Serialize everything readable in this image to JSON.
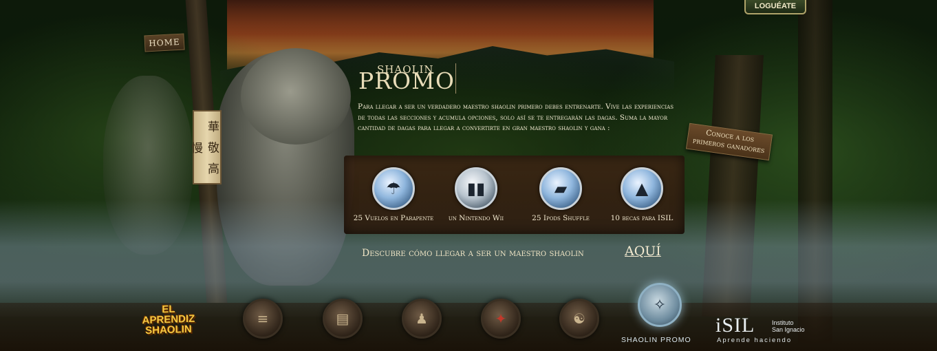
{
  "header": {
    "login_label": "LOGUÉATE",
    "home_label": "HOME"
  },
  "banner": {
    "characters": "華 敬 高 慢"
  },
  "promo": {
    "logo_small": "SHAOLIN",
    "logo_big": "PROMO",
    "intro": "Para llegar a ser un verdadero maestro shaolin primero debes entrenarte. Vive las experiencias de todas las secciones y acumula opciones, solo así se te entregarán las dagas. Suma la mayor cantidad de dagas para llegar a convertirte en gran maestro shaolin y gana :",
    "winners_label": "Conoce a los primeros ganadores",
    "prizes": [
      {
        "label": "25 Vuelos en Parapente",
        "icon": "paraglider-icon"
      },
      {
        "label": "un Nintendo Wii",
        "icon": "wii-console-icon"
      },
      {
        "label": "25 Ipods Shuffle",
        "icon": "ipod-shuffle-icon"
      },
      {
        "label": "10 becas para ISIL",
        "icon": "graduation-cap-icon"
      }
    ],
    "discover_text": "Descubre cómo llegar a ser un maestro shaolin",
    "discover_link": "AQUÍ"
  },
  "nav": {
    "active_label": "SHAOLIN PROMO"
  },
  "brand": {
    "aprendiz_line1": "EL",
    "aprendiz_line2": "APRENDIZ",
    "aprendiz_line3": "SHAOLIN"
  },
  "isil": {
    "logo": "iSIL",
    "sub1": "Instituto",
    "sub2": "San Ignacio",
    "tagline": "Aprende haciendo"
  }
}
